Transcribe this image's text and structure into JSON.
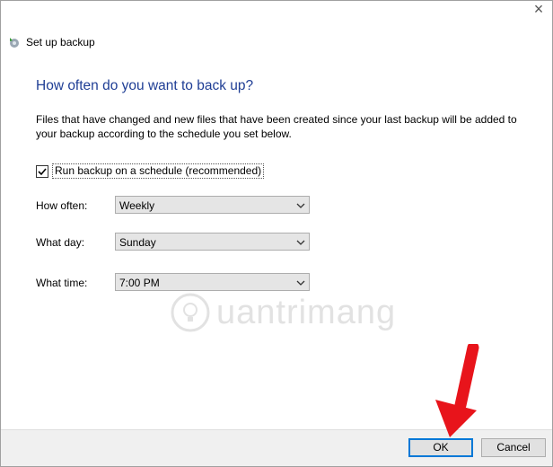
{
  "window": {
    "title": "Set up backup",
    "close_glyph": "×"
  },
  "main": {
    "heading": "How often do you want to back up?",
    "description": "Files that have changed and new files that have been created since your last backup will be added to your backup according to the schedule you set below.",
    "schedule_checkbox": {
      "label": "Run backup on a schedule (recommended)",
      "checked": true
    },
    "fields": {
      "how_often": {
        "label": "How often:",
        "value": "Weekly"
      },
      "what_day": {
        "label": "What day:",
        "value": "Sunday"
      },
      "what_time": {
        "label": "What time:",
        "value": "7:00 PM"
      }
    }
  },
  "watermark": {
    "text": "uantrimang"
  },
  "buttons": {
    "ok": "OK",
    "cancel": "Cancel"
  },
  "colors": {
    "heading": "#1f3e95",
    "ok_border": "#0078d7",
    "annotation_arrow": "#e8141b"
  },
  "icons": {
    "app": "backup-icon",
    "close": "close-icon",
    "dropdown": "chevron-down-icon",
    "check": "check-icon"
  }
}
